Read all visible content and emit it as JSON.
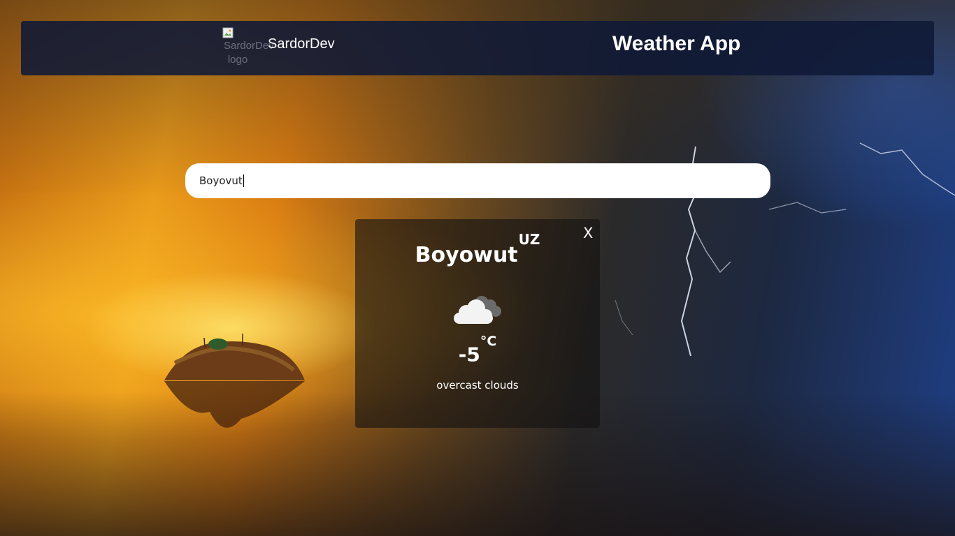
{
  "header": {
    "logo_alt": "SardorDev logo",
    "brand": "SardorDev",
    "title": "Weather App"
  },
  "search": {
    "value": "Boyovut"
  },
  "weather_card": {
    "close_label": "X",
    "city": "Boyowut",
    "country": "UZ",
    "temperature": "-5",
    "unit": "°C",
    "description": "overcast clouds",
    "icon": "overcast-clouds-icon"
  },
  "colors": {
    "navbar": "#0f1937",
    "card": "#141212",
    "search_bg": "#ffffff",
    "text": "#ffffff"
  }
}
